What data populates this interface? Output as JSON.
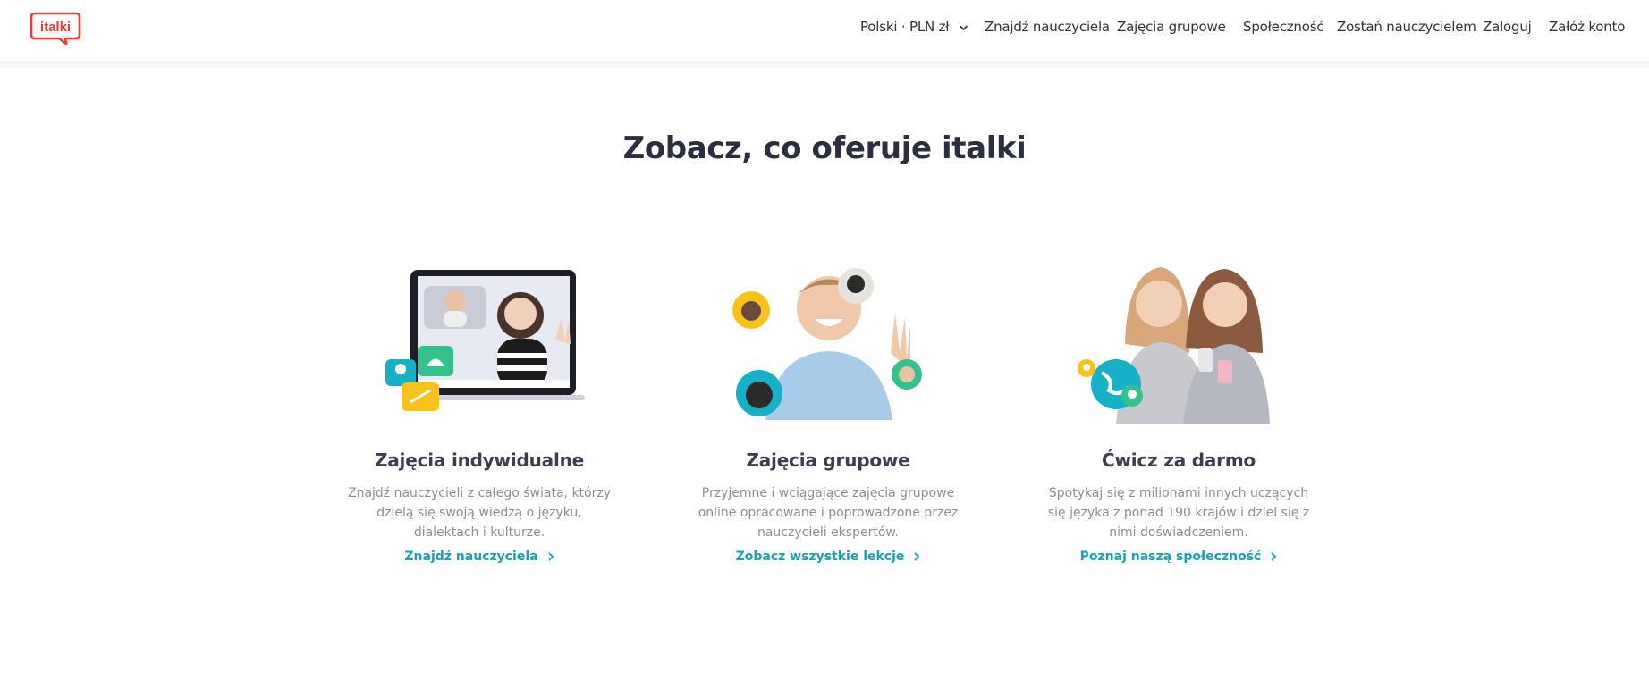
{
  "brand": {
    "logo_text": "italki",
    "accent": "#ef3a33",
    "link_color": "#18a1b4"
  },
  "nav": {
    "language_currency": "Polski · PLN zł",
    "items": [
      "Znajdź nauczyciela",
      "Zajęcia grupowe",
      "Społeczność",
      "Zostań nauczycielem",
      "Zaloguj",
      "Załóż konto"
    ]
  },
  "main": {
    "heading": "Zobacz, co oferuje italki",
    "cards": [
      {
        "title": "Zajęcia indywidualne",
        "description": "Znajdź nauczycieli z całego świata, którzy dzielą się swoją wiedzą o języku, dialektach i kulturze.",
        "link": "Znajdź nauczyciela"
      },
      {
        "title": "Zajęcia grupowe",
        "description": "Przyjemne i wciągające zajęcia grupowe online opracowane i poprowadzone przez nauczycieli ekspertów.",
        "link": "Zobacz wszystkie lekcje"
      },
      {
        "title": "Ćwicz za darmo",
        "description": "Spotykaj się z milionami innych uczących się języka z ponad 190 krajów i dziel się z nimi doświadczeniem.",
        "link": "Poznaj naszą społeczność"
      }
    ]
  },
  "icons": [
    "chevron-down-icon",
    "chevron-right-icon"
  ]
}
